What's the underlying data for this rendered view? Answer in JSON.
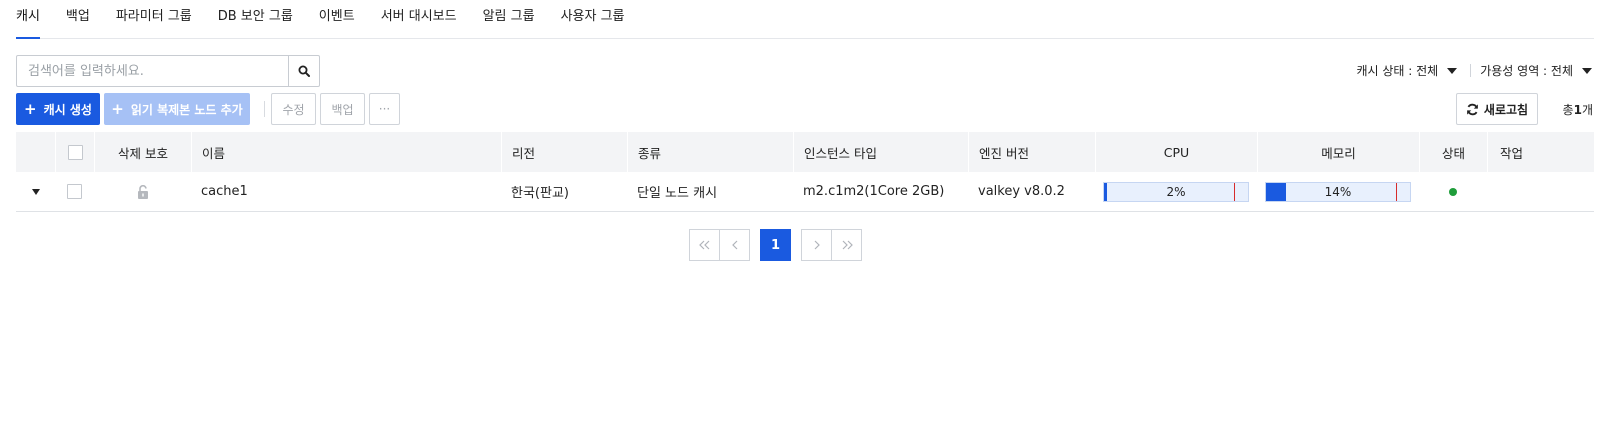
{
  "tabs": [
    {
      "label": "캐시",
      "active": true
    },
    {
      "label": "백업",
      "active": false
    },
    {
      "label": "파라미터 그룹",
      "active": false
    },
    {
      "label": "DB 보안 그룹",
      "active": false
    },
    {
      "label": "이벤트",
      "active": false
    },
    {
      "label": "서버 대시보드",
      "active": false
    },
    {
      "label": "알림 그룹",
      "active": false
    },
    {
      "label": "사용자 그룹",
      "active": false
    }
  ],
  "search": {
    "placeholder": "검색어를 입력하세요.",
    "value": ""
  },
  "filters": {
    "cache_status": "캐시 상태 : 전체",
    "availability_zone": "가용성 영역 : 전체"
  },
  "toolbar": {
    "create_label": "캐시 생성",
    "add_replica_label": "읽기 복제본 노드 추가",
    "edit_label": "수정",
    "backup_label": "백업",
    "more_label": "···",
    "refresh_label": "새로고침"
  },
  "total": {
    "prefix": "총",
    "count": "1",
    "suffix": "개"
  },
  "table": {
    "columns": {
      "delete_protection": "삭제 보호",
      "name": "이름",
      "region": "리전",
      "type": "종류",
      "instance_type": "인스턴스 타입",
      "engine_version": "엔진 버전",
      "cpu": "CPU",
      "memory": "메모리",
      "status": "상태",
      "actions": "작업"
    },
    "rows": [
      {
        "name": "cache1",
        "region": "한국(판교)",
        "type": "단일 노드 캐시",
        "instance_type": "m2.c1m2(1Core 2GB)",
        "engine_version": "valkey v8.0.2",
        "cpu_label": "2%",
        "cpu_value": 0.02,
        "cpu_threshold": 0.9,
        "memory_label": "14%",
        "memory_value": 0.14,
        "memory_threshold": 0.9,
        "status_color": "#1f9d3a"
      }
    ]
  },
  "pagination": {
    "current_page": "1"
  },
  "colors": {
    "accent": "#1a5ae0",
    "accent_disabled": "#a6c1f5",
    "threshold": "#d62b2b"
  }
}
